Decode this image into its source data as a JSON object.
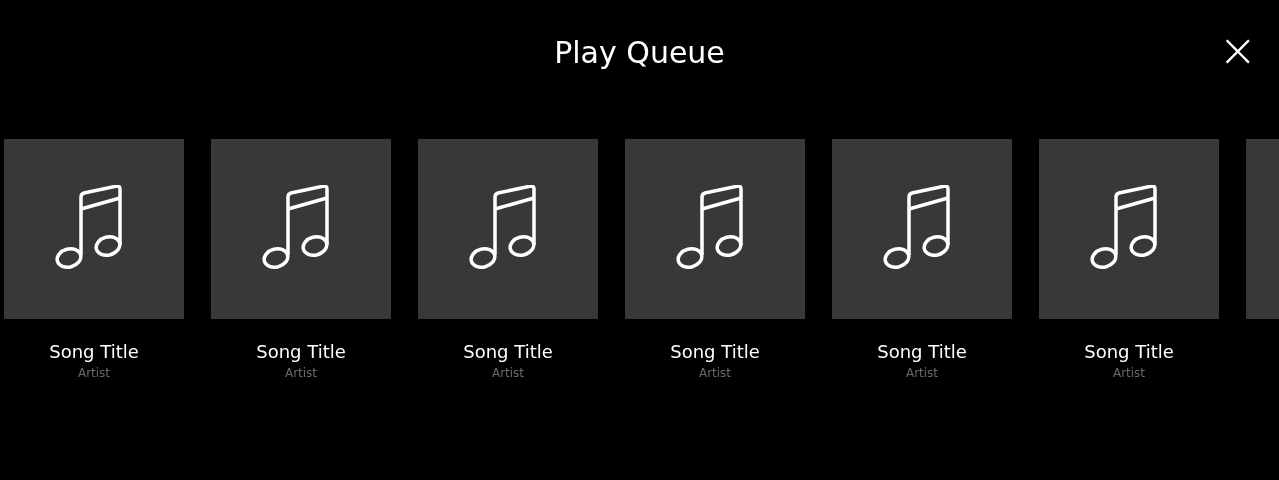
{
  "header": {
    "title": "Play Queue",
    "close": "×"
  },
  "queue": [
    {
      "kind": "song",
      "title": "Song Title",
      "artist": "Artist"
    },
    {
      "kind": "song",
      "title": "Song Title",
      "artist": "Artist"
    },
    {
      "kind": "song",
      "title": "Song Title",
      "artist": "Artist"
    },
    {
      "kind": "song",
      "title": "Song Title",
      "artist": "Artist"
    },
    {
      "kind": "song",
      "title": "Song Title",
      "artist": "Artist"
    },
    {
      "kind": "song",
      "title": "Song Title",
      "artist": "Artist"
    },
    {
      "kind": "cut_off"
    }
  ]
}
